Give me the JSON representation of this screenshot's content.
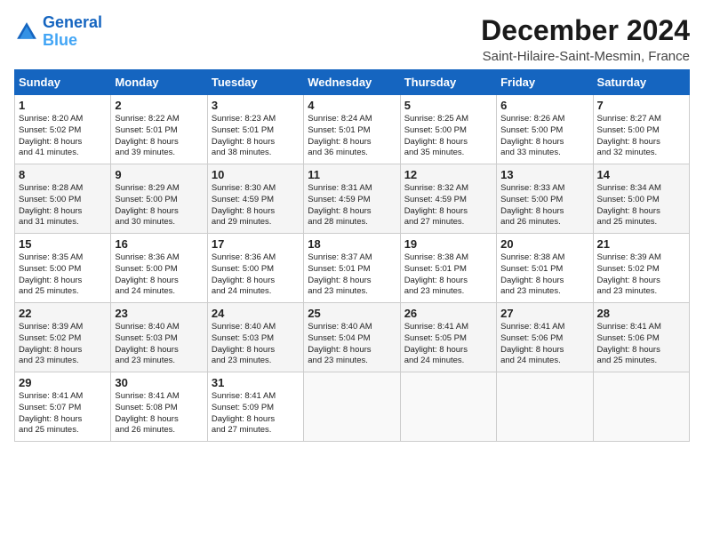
{
  "header": {
    "logo_line1": "General",
    "logo_line2": "Blue",
    "month": "December 2024",
    "location": "Saint-Hilaire-Saint-Mesmin, France"
  },
  "weekdays": [
    "Sunday",
    "Monday",
    "Tuesday",
    "Wednesday",
    "Thursday",
    "Friday",
    "Saturday"
  ],
  "weeks": [
    [
      {
        "day": "1",
        "lines": [
          "Sunrise: 8:20 AM",
          "Sunset: 5:02 PM",
          "Daylight: 8 hours",
          "and 41 minutes."
        ]
      },
      {
        "day": "2",
        "lines": [
          "Sunrise: 8:22 AM",
          "Sunset: 5:01 PM",
          "Daylight: 8 hours",
          "and 39 minutes."
        ]
      },
      {
        "day": "3",
        "lines": [
          "Sunrise: 8:23 AM",
          "Sunset: 5:01 PM",
          "Daylight: 8 hours",
          "and 38 minutes."
        ]
      },
      {
        "day": "4",
        "lines": [
          "Sunrise: 8:24 AM",
          "Sunset: 5:01 PM",
          "Daylight: 8 hours",
          "and 36 minutes."
        ]
      },
      {
        "day": "5",
        "lines": [
          "Sunrise: 8:25 AM",
          "Sunset: 5:00 PM",
          "Daylight: 8 hours",
          "and 35 minutes."
        ]
      },
      {
        "day": "6",
        "lines": [
          "Sunrise: 8:26 AM",
          "Sunset: 5:00 PM",
          "Daylight: 8 hours",
          "and 33 minutes."
        ]
      },
      {
        "day": "7",
        "lines": [
          "Sunrise: 8:27 AM",
          "Sunset: 5:00 PM",
          "Daylight: 8 hours",
          "and 32 minutes."
        ]
      }
    ],
    [
      {
        "day": "8",
        "lines": [
          "Sunrise: 8:28 AM",
          "Sunset: 5:00 PM",
          "Daylight: 8 hours",
          "and 31 minutes."
        ]
      },
      {
        "day": "9",
        "lines": [
          "Sunrise: 8:29 AM",
          "Sunset: 5:00 PM",
          "Daylight: 8 hours",
          "and 30 minutes."
        ]
      },
      {
        "day": "10",
        "lines": [
          "Sunrise: 8:30 AM",
          "Sunset: 4:59 PM",
          "Daylight: 8 hours",
          "and 29 minutes."
        ]
      },
      {
        "day": "11",
        "lines": [
          "Sunrise: 8:31 AM",
          "Sunset: 4:59 PM",
          "Daylight: 8 hours",
          "and 28 minutes."
        ]
      },
      {
        "day": "12",
        "lines": [
          "Sunrise: 8:32 AM",
          "Sunset: 4:59 PM",
          "Daylight: 8 hours",
          "and 27 minutes."
        ]
      },
      {
        "day": "13",
        "lines": [
          "Sunrise: 8:33 AM",
          "Sunset: 5:00 PM",
          "Daylight: 8 hours",
          "and 26 minutes."
        ]
      },
      {
        "day": "14",
        "lines": [
          "Sunrise: 8:34 AM",
          "Sunset: 5:00 PM",
          "Daylight: 8 hours",
          "and 25 minutes."
        ]
      }
    ],
    [
      {
        "day": "15",
        "lines": [
          "Sunrise: 8:35 AM",
          "Sunset: 5:00 PM",
          "Daylight: 8 hours",
          "and 25 minutes."
        ]
      },
      {
        "day": "16",
        "lines": [
          "Sunrise: 8:36 AM",
          "Sunset: 5:00 PM",
          "Daylight: 8 hours",
          "and 24 minutes."
        ]
      },
      {
        "day": "17",
        "lines": [
          "Sunrise: 8:36 AM",
          "Sunset: 5:00 PM",
          "Daylight: 8 hours",
          "and 24 minutes."
        ]
      },
      {
        "day": "18",
        "lines": [
          "Sunrise: 8:37 AM",
          "Sunset: 5:01 PM",
          "Daylight: 8 hours",
          "and 23 minutes."
        ]
      },
      {
        "day": "19",
        "lines": [
          "Sunrise: 8:38 AM",
          "Sunset: 5:01 PM",
          "Daylight: 8 hours",
          "and 23 minutes."
        ]
      },
      {
        "day": "20",
        "lines": [
          "Sunrise: 8:38 AM",
          "Sunset: 5:01 PM",
          "Daylight: 8 hours",
          "and 23 minutes."
        ]
      },
      {
        "day": "21",
        "lines": [
          "Sunrise: 8:39 AM",
          "Sunset: 5:02 PM",
          "Daylight: 8 hours",
          "and 23 minutes."
        ]
      }
    ],
    [
      {
        "day": "22",
        "lines": [
          "Sunrise: 8:39 AM",
          "Sunset: 5:02 PM",
          "Daylight: 8 hours",
          "and 23 minutes."
        ]
      },
      {
        "day": "23",
        "lines": [
          "Sunrise: 8:40 AM",
          "Sunset: 5:03 PM",
          "Daylight: 8 hours",
          "and 23 minutes."
        ]
      },
      {
        "day": "24",
        "lines": [
          "Sunrise: 8:40 AM",
          "Sunset: 5:03 PM",
          "Daylight: 8 hours",
          "and 23 minutes."
        ]
      },
      {
        "day": "25",
        "lines": [
          "Sunrise: 8:40 AM",
          "Sunset: 5:04 PM",
          "Daylight: 8 hours",
          "and 23 minutes."
        ]
      },
      {
        "day": "26",
        "lines": [
          "Sunrise: 8:41 AM",
          "Sunset: 5:05 PM",
          "Daylight: 8 hours",
          "and 24 minutes."
        ]
      },
      {
        "day": "27",
        "lines": [
          "Sunrise: 8:41 AM",
          "Sunset: 5:06 PM",
          "Daylight: 8 hours",
          "and 24 minutes."
        ]
      },
      {
        "day": "28",
        "lines": [
          "Sunrise: 8:41 AM",
          "Sunset: 5:06 PM",
          "Daylight: 8 hours",
          "and 25 minutes."
        ]
      }
    ],
    [
      {
        "day": "29",
        "lines": [
          "Sunrise: 8:41 AM",
          "Sunset: 5:07 PM",
          "Daylight: 8 hours",
          "and 25 minutes."
        ]
      },
      {
        "day": "30",
        "lines": [
          "Sunrise: 8:41 AM",
          "Sunset: 5:08 PM",
          "Daylight: 8 hours",
          "and 26 minutes."
        ]
      },
      {
        "day": "31",
        "lines": [
          "Sunrise: 8:41 AM",
          "Sunset: 5:09 PM",
          "Daylight: 8 hours",
          "and 27 minutes."
        ]
      },
      null,
      null,
      null,
      null
    ]
  ]
}
